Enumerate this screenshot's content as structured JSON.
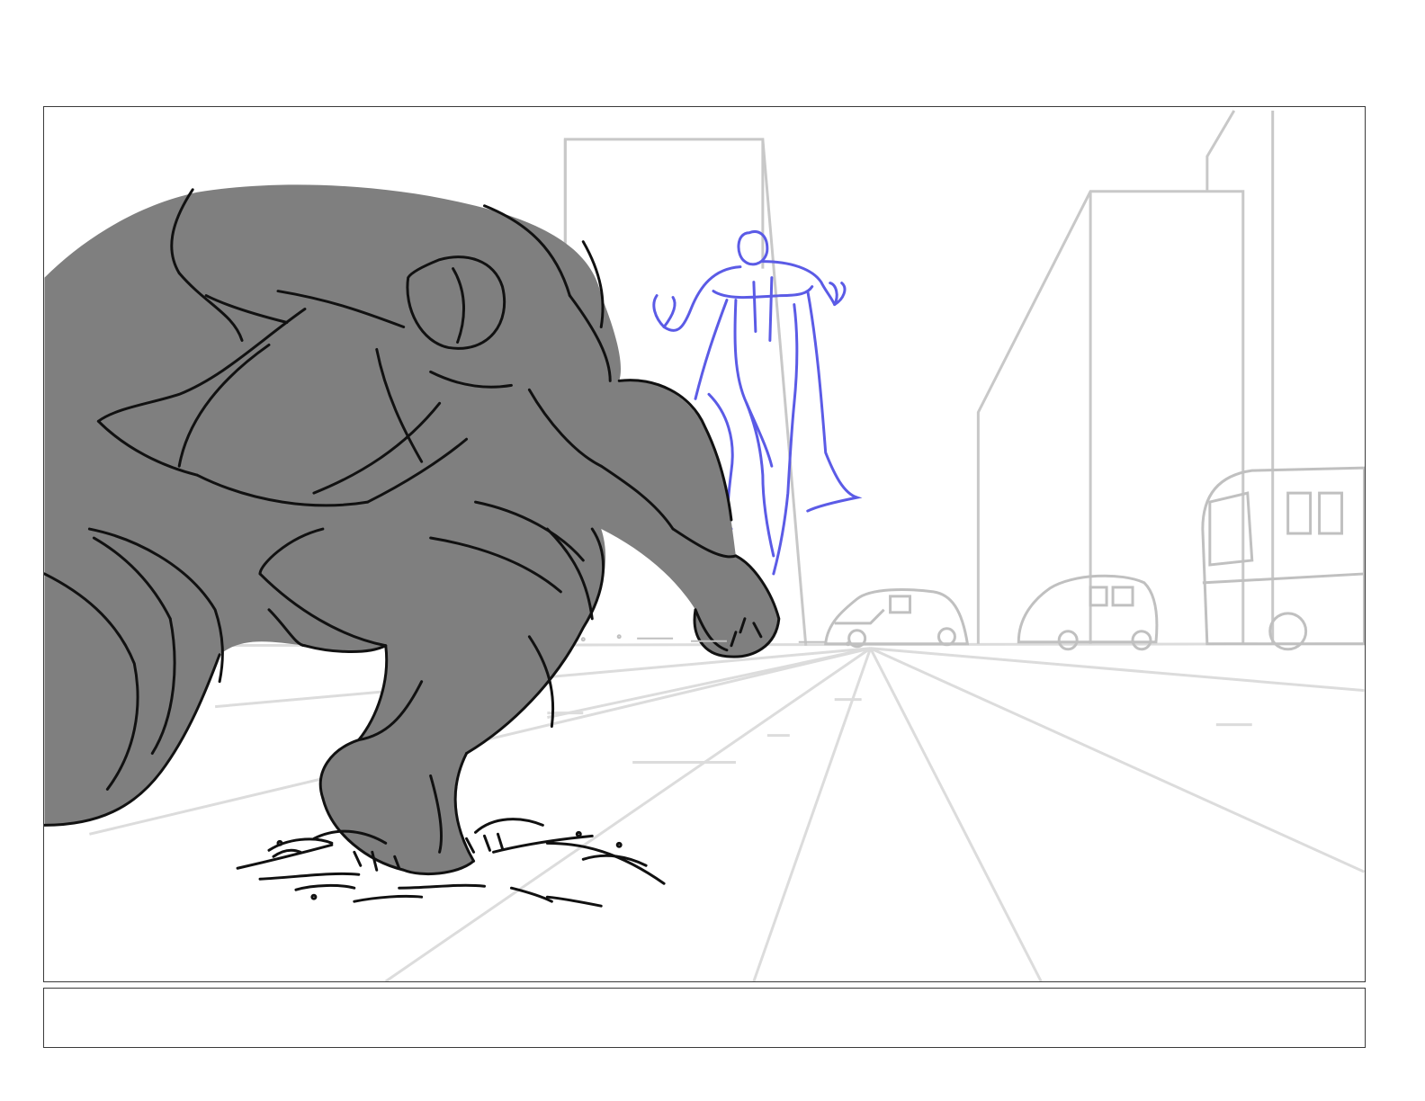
{
  "storyboard": {
    "panel": {
      "caption_text": ""
    }
  },
  "colors": {
    "page_background": "#ffffff",
    "frame_border": "#3a3a3a",
    "perspective_lines": "#d9d9d9",
    "background_buildings": "#c8c8c8",
    "brute_fill": "#7f7f7f",
    "ink_lines": "#111111",
    "hero_figure_lines": "#5b5be6"
  },
  "icons": {
    "brute_figure": "crouching-brute-figure",
    "hero_figure": "caped-hero-figure",
    "car_left": "car-sketch",
    "car_middle": "car-sketch",
    "bus_right": "bus-sketch",
    "building_left": "building-sketch",
    "building_right": "building-sketch",
    "rubble": "rubble-debris"
  }
}
